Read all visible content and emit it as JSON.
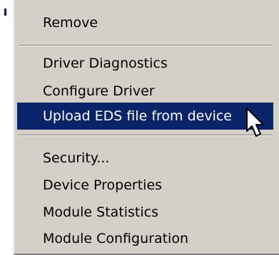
{
  "menu": {
    "items": [
      {
        "label": "Remove"
      },
      {
        "label": "Driver Diagnostics"
      },
      {
        "label": "Configure Driver"
      },
      {
        "label": "Upload EDS file from device",
        "highlighted": true
      },
      {
        "label": "Security..."
      },
      {
        "label": "Device Properties"
      },
      {
        "label": "Module Statistics"
      },
      {
        "label": "Module Configuration"
      }
    ]
  },
  "colors": {
    "menu_background": "#d4d0c8",
    "highlight_background": "#0a246a",
    "highlight_text": "#ffffff",
    "text": "#000000"
  },
  "icons": {
    "cursor": "arrow-cursor-icon"
  }
}
